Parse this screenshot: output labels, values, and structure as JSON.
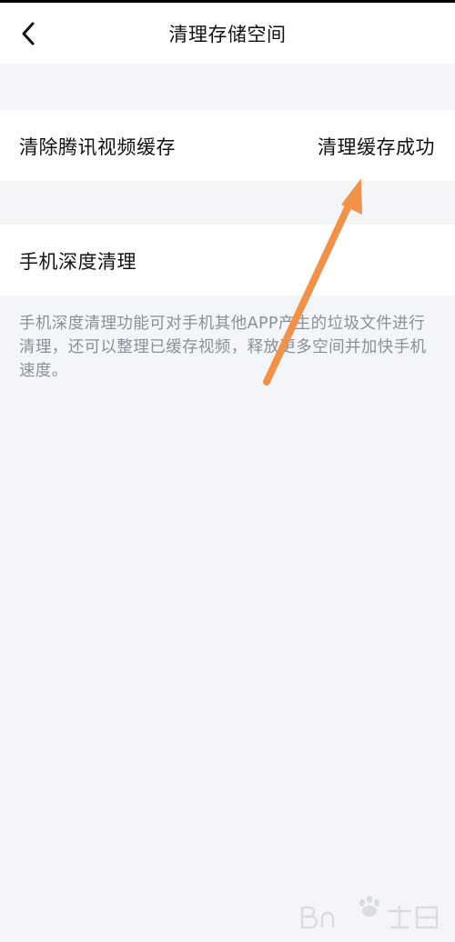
{
  "header": {
    "back_icon": "chevron-left-icon",
    "title": "清理存储空间"
  },
  "rows": [
    {
      "label": "清除腾讯视频缓存",
      "status": "清理缓存成功"
    },
    {
      "label": "手机深度清理",
      "status": ""
    }
  ],
  "description": "手机深度清理功能可对手机其他APP产生的垃圾文件进行清理，还可以整理已缓存视频，释放更多空间并加快手机速度。",
  "annotation": {
    "arrow_icon": "arrow-up-right-icon",
    "color": "#f0924a"
  },
  "colors": {
    "background": "#f3f5f8",
    "surface": "#ffffff",
    "text": "#111111",
    "secondary_text": "#8a8f99"
  },
  "watermark": {
    "logo": "baidu-jingyan-watermark"
  }
}
